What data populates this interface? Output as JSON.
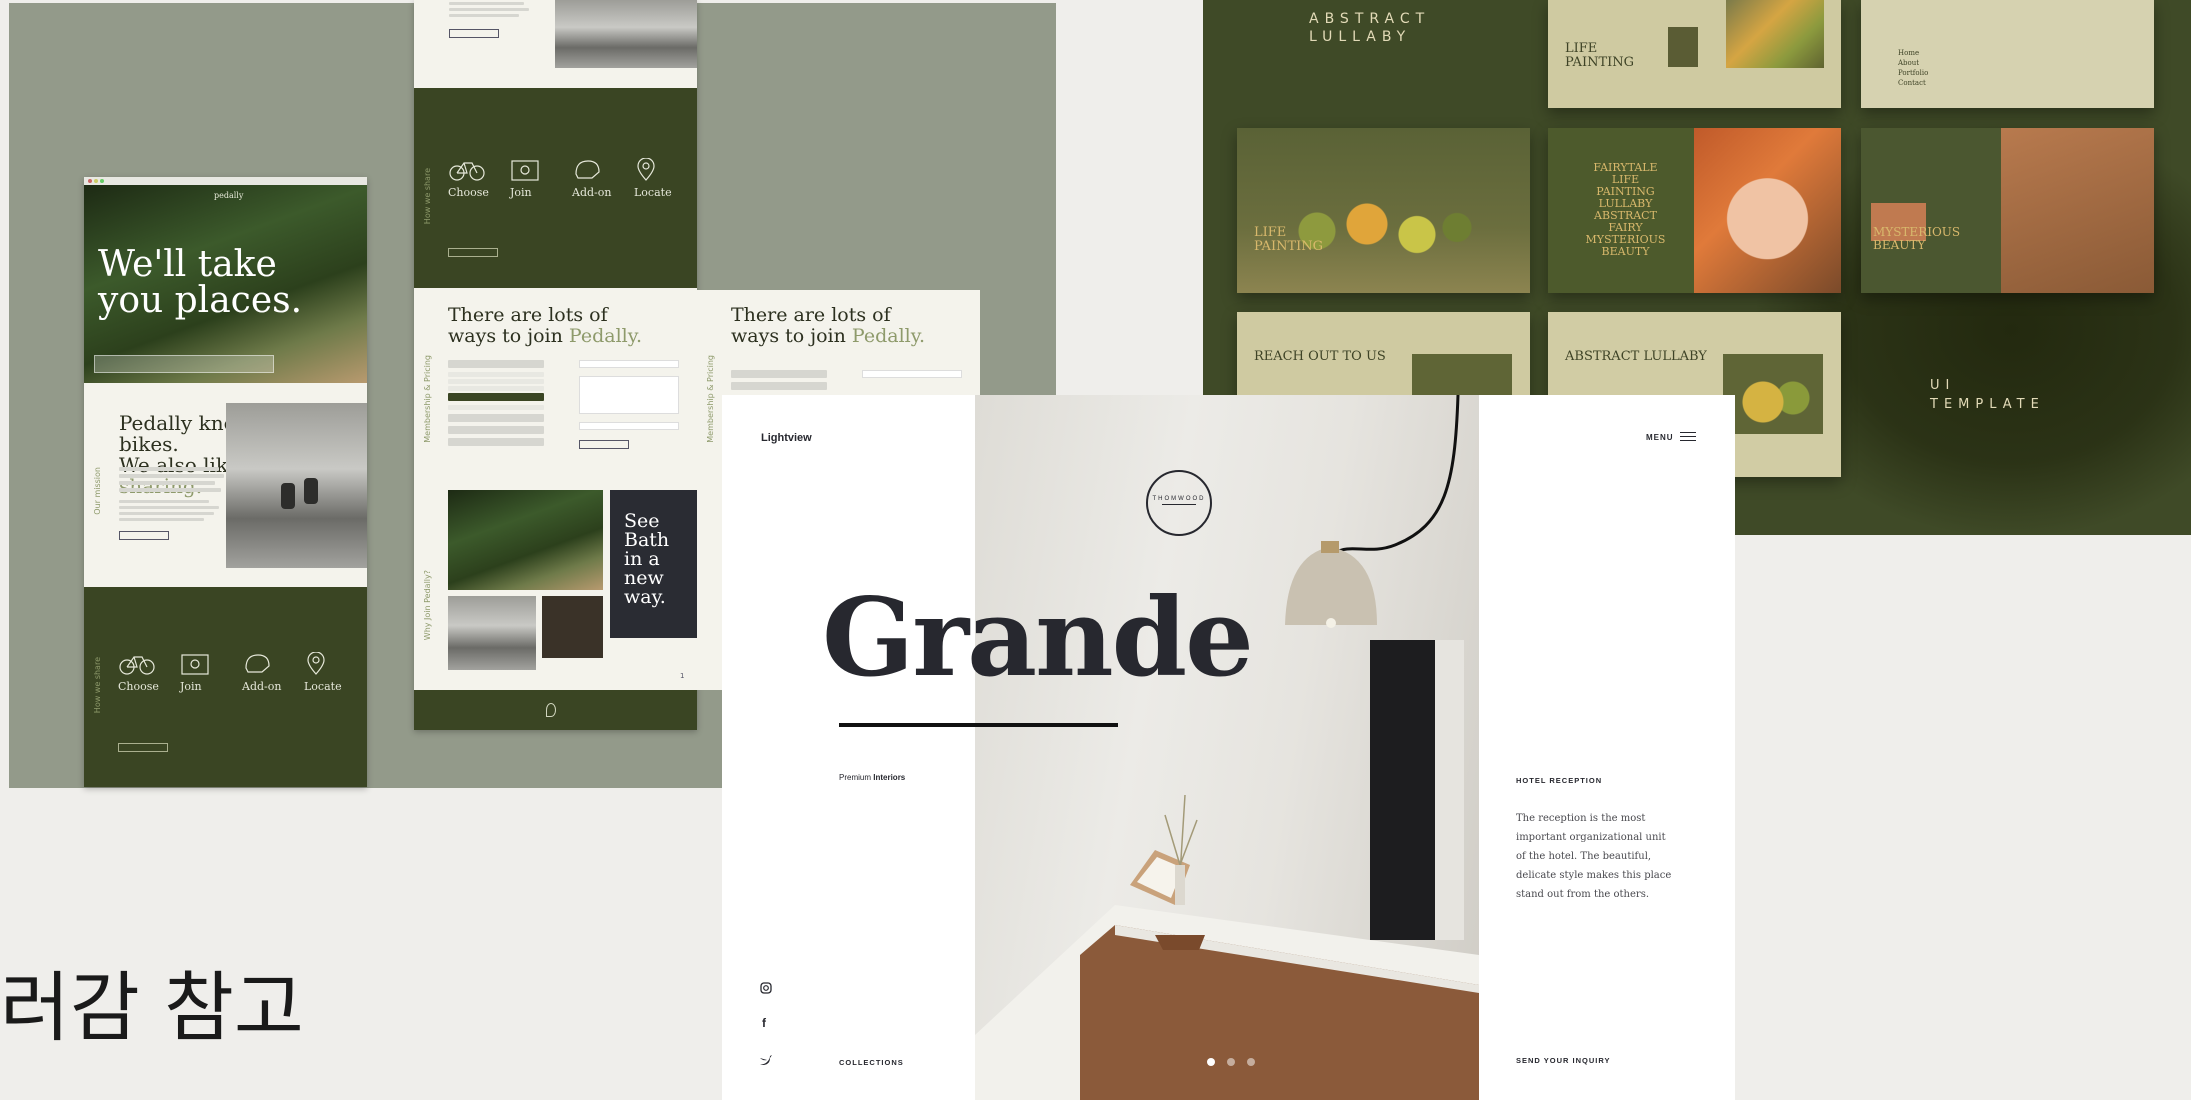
{
  "pedally": {
    "hero_title_line1": "We'll take",
    "hero_title_line2": "you places.",
    "knows_line1": "Pedally knows bikes.",
    "knows_line2": "We also like",
    "knows_accent": "sharing.",
    "side_label_mission": "Our mission",
    "side_label_how": "How we share",
    "side_label_membership": "Membership & Pricing",
    "side_label_why": "Why Join Pedally?",
    "join_line1": "There are lots of",
    "join_line2": "ways to join",
    "join_accent": "Pedally.",
    "see_bath": [
      "See",
      "Bath",
      "in a",
      "new",
      "way."
    ],
    "steps": [
      {
        "label": "Choose",
        "icon": "bicycle-icon"
      },
      {
        "label": "Join",
        "icon": "card-icon"
      },
      {
        "label": "Add-on",
        "icon": "helmet-icon"
      },
      {
        "label": "Locate",
        "icon": "location-pin-icon"
      }
    ],
    "page_number": "1"
  },
  "lullaby": {
    "title_line1": "ABSTRACT",
    "title_line2": "LULLABY",
    "life_painting": [
      "LIFE",
      "PAINTING"
    ],
    "fairytale": [
      "FAIRYTALE",
      "LIFE",
      "PAINTING",
      "LULLABY",
      "ABSTRACT",
      "FAIRY",
      "MYSTERIOUS",
      "BEAUTY"
    ],
    "mysterious": [
      "MYSTERIOUS",
      "BEAUTY"
    ],
    "reach_out": "REACH OUT TO US",
    "abstract_lullaby": "ABSTRACT LULLABY",
    "ui_template_line1": "UI",
    "ui_template_line2": "TEMPLATE",
    "menu_items": [
      "Home",
      "About",
      "Portfolio",
      "Contact"
    ]
  },
  "grande": {
    "brand": "Lightview",
    "menu_label": "MENU",
    "badge_text": "THOMWOOD",
    "title": "Grande",
    "subtitle_light": "Premium",
    "subtitle_bold": "Interiors",
    "section_heading": "HOTEL RECEPTION",
    "section_body": "The reception is the most important organizational unit of the hotel. The beautiful, delicate style makes this place stand out from the others.",
    "collections_link": "COLLECTIONS",
    "inquiry_link": "SEND YOUR INQUIRY",
    "social": [
      "instagram-icon",
      "facebook-icon",
      "twitter-icon"
    ]
  },
  "korean_caption": "러감 참고",
  "colors": {
    "olive_dark": "#3a4523",
    "sage_board": "#939a8a",
    "lullaby_bg": "#3f4a27",
    "grande_ink": "#27282f",
    "gold": "#d8b86c"
  }
}
